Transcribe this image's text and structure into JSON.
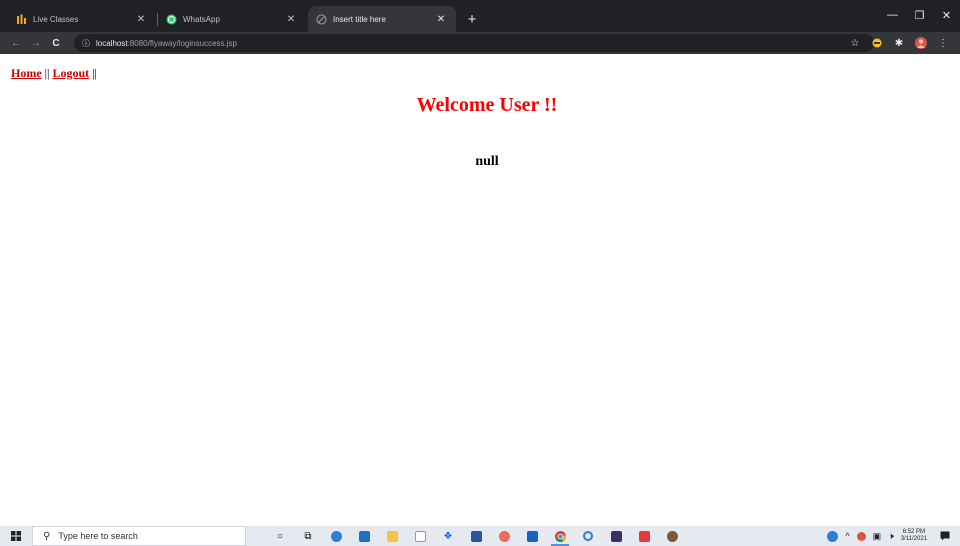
{
  "browser": {
    "tabs": [
      {
        "title": "Live Classes",
        "icon": "live-classes-icon",
        "active": false
      },
      {
        "title": "WhatsApp",
        "icon": "whatsapp-icon",
        "active": false
      },
      {
        "title": "Insert title here",
        "icon": "page-icon",
        "active": true
      }
    ],
    "new_tab_label": "+",
    "url_host": "localhost",
    "url_path": ":8080/flyaway/loginsuccess.jsp",
    "colors": {
      "tabstrip": "#202124",
      "toolbar": "#35363a"
    }
  },
  "page": {
    "nav": {
      "home_label": "Home",
      "separator": "||",
      "logout_label": "Logout"
    },
    "welcome_text": "Welcome User !!",
    "message_text": "null",
    "colors": {
      "link": "#d00000",
      "welcome": "#ff0000"
    }
  },
  "taskbar": {
    "search_placeholder": "Type here to search",
    "clock_time": "6:52 PM",
    "clock_date": "3/11/2021"
  }
}
